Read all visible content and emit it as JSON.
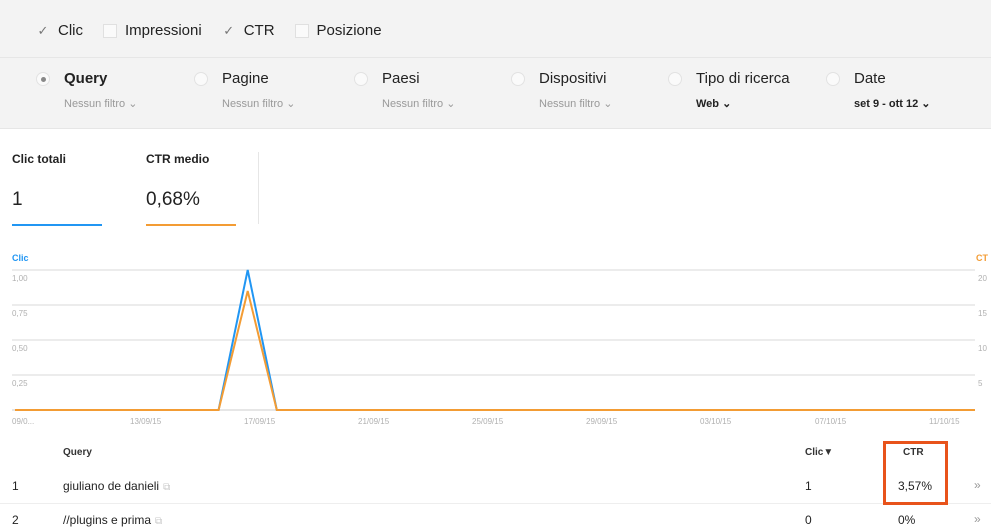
{
  "metrics": [
    {
      "label": "Clic",
      "checked": true
    },
    {
      "label": "Impressioni",
      "checked": false
    },
    {
      "label": "CTR",
      "checked": true
    },
    {
      "label": "Posizione",
      "checked": false
    }
  ],
  "dimensions": [
    {
      "name": "Query",
      "filter": "Nessun filtro",
      "selected": true
    },
    {
      "name": "Pagine",
      "filter": "Nessun filtro",
      "selected": false
    },
    {
      "name": "Paesi",
      "filter": "Nessun filtro",
      "selected": false
    },
    {
      "name": "Dispositivi",
      "filter": "Nessun filtro",
      "selected": false
    },
    {
      "name": "Tipo di ricerca",
      "filter": "Web",
      "selected": false
    },
    {
      "name": "Date",
      "filter": "set 9 - ott 12",
      "selected": false
    }
  ],
  "totals": [
    {
      "label": "Clic totali",
      "value": "1",
      "color": "#2196f3"
    },
    {
      "label": "CTR medio",
      "value": "0,68%",
      "color": "#f39c34"
    }
  ],
  "chart": {
    "left_axis_title": "Clic",
    "right_axis_title": "CT",
    "left_ticks": [
      "1,00",
      "0,75",
      "0,50",
      "0,25"
    ],
    "right_ticks": [
      "20",
      "15",
      "10",
      "5"
    ],
    "x_ticks": [
      "09/0...",
      "13/09/15",
      "17/09/15",
      "21/09/15",
      "25/09/15",
      "29/09/15",
      "03/10/15",
      "07/10/15",
      "11/10/15"
    ]
  },
  "chart_data": {
    "type": "line",
    "x": [
      "09/09/15",
      "10/09/15",
      "11/09/15",
      "12/09/15",
      "13/09/15",
      "14/09/15",
      "15/09/15",
      "16/09/15",
      "17/09/15",
      "18/09/15",
      "19/09/15",
      "20/09/15",
      "21/09/15",
      "22/09/15",
      "23/09/15",
      "24/09/15",
      "25/09/15",
      "26/09/15",
      "27/09/15",
      "28/09/15",
      "29/09/15",
      "30/09/15",
      "01/10/15",
      "02/10/15",
      "03/10/15",
      "04/10/15",
      "05/10/15",
      "06/10/15",
      "07/10/15",
      "08/10/15",
      "09/10/15",
      "10/10/15",
      "11/10/15",
      "12/10/15"
    ],
    "series": [
      {
        "name": "Clic",
        "color": "#2196f3",
        "axis": "left",
        "values": [
          0,
          0,
          0,
          0,
          0,
          0,
          0,
          0,
          1,
          0,
          0,
          0,
          0,
          0,
          0,
          0,
          0,
          0,
          0,
          0,
          0,
          0,
          0,
          0,
          0,
          0,
          0,
          0,
          0,
          0,
          0,
          0,
          0,
          0
        ]
      },
      {
        "name": "CTR",
        "color": "#f39c34",
        "axis": "right",
        "values": [
          0,
          0,
          0,
          0,
          0,
          0,
          0,
          0,
          17,
          0,
          0,
          0,
          0,
          0,
          0,
          0,
          0,
          0,
          0,
          0,
          0,
          0,
          0,
          0,
          0,
          0,
          0,
          0,
          0,
          0,
          0,
          0,
          0,
          0
        ]
      }
    ],
    "ylim_left": [
      0,
      1
    ],
    "ylim_right": [
      0,
      20
    ],
    "grid": true
  },
  "table": {
    "headers": {
      "query": "Query",
      "clic": "Clic▼",
      "ctr": "CTR"
    },
    "rows": [
      {
        "num": "1",
        "query": "giuliano de danieli",
        "clic": "1",
        "ctr": "3,57%"
      },
      {
        "num": "2",
        "query": "//plugins e prima",
        "clic": "0",
        "ctr": "0%"
      }
    ],
    "row_action": "»"
  },
  "icons": {
    "check": "✓",
    "dropdown": "⌄",
    "external": "external-link-icon"
  },
  "colors": {
    "highlight": "#e8531b"
  }
}
